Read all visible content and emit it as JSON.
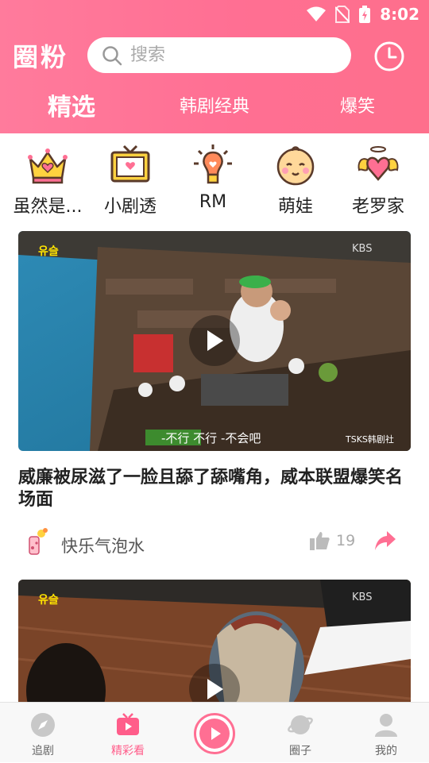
{
  "status": {
    "time": "8:02"
  },
  "header": {
    "logo": "圈粉",
    "search_placeholder": "搜索"
  },
  "tabs": [
    {
      "label": "精选",
      "active": true
    },
    {
      "label": "韩剧经典",
      "active": false
    },
    {
      "label": "爆笑",
      "active": false
    }
  ],
  "categories": [
    {
      "label": "虽然是...",
      "icon": "crown-icon"
    },
    {
      "label": "小剧透",
      "icon": "tv-icon"
    },
    {
      "label": "RM",
      "icon": "lightbulb-icon"
    },
    {
      "label": "萌娃",
      "icon": "baby-face-icon"
    },
    {
      "label": "老罗家",
      "icon": "winged-heart-icon"
    }
  ],
  "posts": [
    {
      "title": "威廉被尿滋了一脸且舔了舔嘴角，威本联盟爆笑名场面",
      "author": "快乐气泡水",
      "likes": "19",
      "subtitle": "-不行 不行 -不会吧",
      "watermark": "KBS",
      "source_tag": "TSKS韩剧社"
    },
    {
      "watermark": "KBS"
    }
  ],
  "bottom_nav": [
    {
      "label": "追剧",
      "icon": "compass-icon",
      "active": false
    },
    {
      "label": "精彩看",
      "icon": "tv-play-icon",
      "active": true
    },
    {
      "label": "圈子",
      "icon": "planet-icon",
      "active": false
    },
    {
      "label": "我的",
      "icon": "user-icon",
      "active": false
    }
  ],
  "colors": {
    "brand": "#ff6f93",
    "active": "#ff5d8a",
    "share": "#ff6f93"
  }
}
